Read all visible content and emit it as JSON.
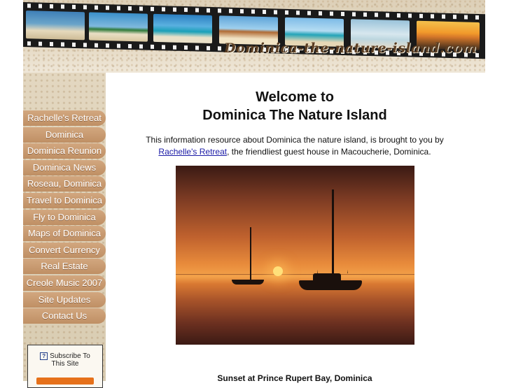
{
  "header": {
    "site_logo_text": "Dominica-the-nature-island.com"
  },
  "nav": {
    "items": [
      {
        "label": "Rachelle's Retreat"
      },
      {
        "label": "Dominica"
      },
      {
        "label": "Dominica Reunion"
      },
      {
        "label": "Dominica News"
      },
      {
        "label": "Roseau, Dominica"
      },
      {
        "label": "Travel to Dominica"
      },
      {
        "label": "Fly to Dominica"
      },
      {
        "label": "Maps of Dominica"
      },
      {
        "label": "Convert Currency"
      },
      {
        "label": "Real Estate"
      },
      {
        "label": "Creole Music 2007"
      },
      {
        "label": "Site Updates"
      },
      {
        "label": "Contact Us"
      }
    ]
  },
  "subscribe": {
    "icon_text": "?",
    "line1": "Subscribe To",
    "line2": "This Site"
  },
  "main": {
    "title_line1": "Welcome to",
    "title_line2": "Dominica The Nature Island",
    "intro_part1": "This information resource about Dominica the nature island, is brought to you by",
    "intro_link": "Rachelle's Retreat",
    "intro_part2": ", the friendliest guest house in Macoucherie, Dominica.",
    "photo_caption": "Sunset at Prince Rupert Bay, Dominica"
  }
}
